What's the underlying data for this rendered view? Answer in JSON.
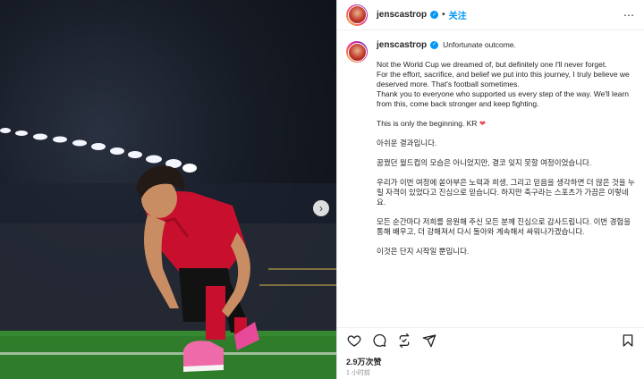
{
  "post": {
    "username": "jenscastrop",
    "follow_label": "关注",
    "dot": "•",
    "more_label": "⋯",
    "carousel_next": "›"
  },
  "caption": {
    "first_line": "Unfortunate outcome.",
    "paragraphs": [
      "Not the World Cup we dreamed of, but definitely one I'll never forget.\nFor the effort, sacrifice, and belief we put into this journey, I truly believe we deserved more. That's football sometimes.\nThank you to everyone who supported us every step of the way. We'll learn from this, come back stronger and keep fighting.",
      "This is only the beginning. KR",
      "아쉬운 결과입니다.",
      "꿈꿨던 월드컵의 모습은 아니었지만, 결코 잊지 못할 여정이었습니다.",
      "우리가 이번 여정에 쏟아부은 노력과 희생, 그리고 믿음을 생각하면 더 많은 것을 누릴 자격이 있었다고 진심으로 믿습니다. 하지만 축구라는 스포츠가 가끔은 이렇네요.",
      "모든 순간마다 저희를 응원해 주신 모든 분께 진심으로 감사드립니다. 이번 경험을 통해 배우고, 더 강해져서 다시 돌아와 계속해서 싸워나가겠습니다.",
      "이것은 단지 시작일 뿐입니다."
    ],
    "heart": "❤"
  },
  "stats": {
    "likes": "2.9万次赞",
    "time": "1 小时前"
  },
  "icons": {
    "like": "heart-outline-icon",
    "comment": "comment-bubble-icon",
    "share": "repost-icon",
    "send": "send-icon",
    "save": "bookmark-icon",
    "verified": "verified-badge-icon"
  },
  "colors": {
    "accent": "#0095f6",
    "heart": "#ed4956",
    "jersey_red": "#c8102e",
    "pitch_green": "#2f7d2a"
  }
}
